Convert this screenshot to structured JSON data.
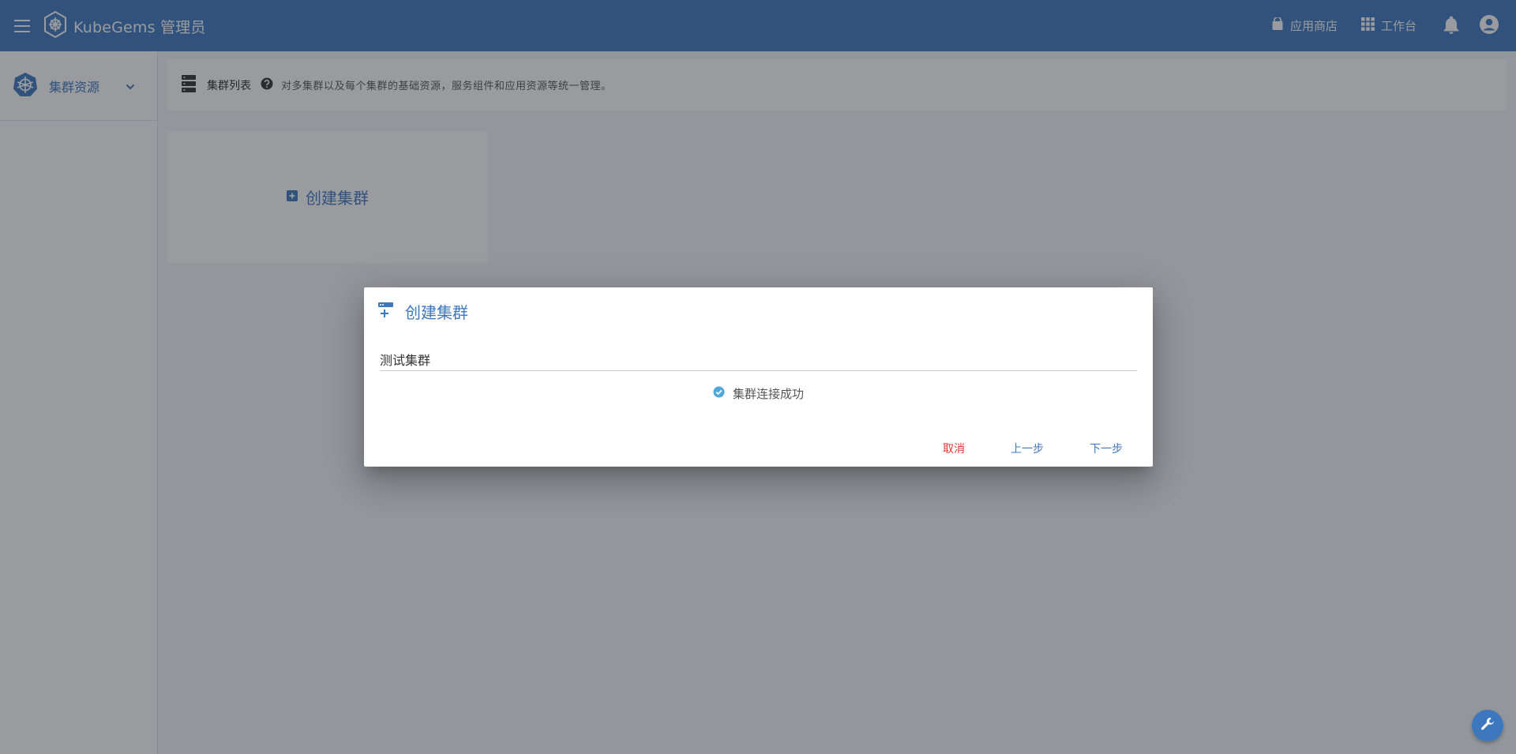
{
  "header": {
    "brand_name": "KubeGems 管理员",
    "app_store_label": "应用商店",
    "workspace_label": "工作台",
    "icons": {
      "menu": "menu-icon",
      "logo": "helm-icon",
      "app_store": "shopping-bag-icon",
      "workspace": "apps-grid-icon",
      "notifications": "bell-icon",
      "account": "account-circle-icon"
    }
  },
  "sidebar": {
    "group_label": "集群资源",
    "icon": "kubernetes-icon",
    "expand_icon": "chevron-down-icon"
  },
  "main": {
    "toolbar_title": "集群列表",
    "toolbar_description": "对多集群以及每个集群的基础资源，服务组件和应用资源等统一管理。",
    "create_card_label": "创建集群"
  },
  "dialog": {
    "title": "创建集群",
    "cluster_name_value": "测试集群",
    "status_text": "集群连接成功",
    "cancel_label": "取消",
    "prev_label": "上一步",
    "next_label": "下一步"
  },
  "colors": {
    "primary": "#3d78bf",
    "danger": "#e53935",
    "success": "#4fa8d8"
  },
  "fab_icon": "wrench-icon"
}
